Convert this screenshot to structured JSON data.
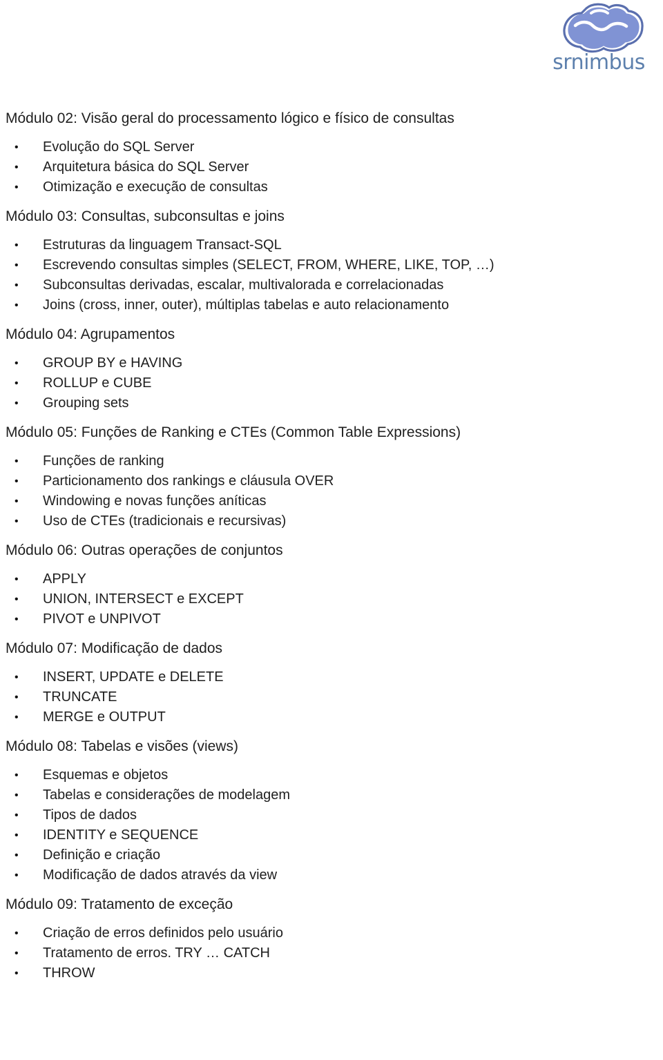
{
  "header": {
    "logo": {
      "icon_name": "cloud-logo-icon",
      "wordmark": "srnimbus",
      "cloud_fill": "#8093d4",
      "cloud_stroke": "#5a6fae",
      "wordmark_color": "#5d80ad"
    }
  },
  "document": {
    "sections": [
      {
        "heading": "Módulo 02: Visão geral do processamento lógico e físico de consultas",
        "items": [
          "Evolução do SQL Server",
          "Arquitetura básica do SQL Server",
          "Otimização e execução de consultas"
        ]
      },
      {
        "heading": "Módulo 03: Consultas, subconsultas e joins",
        "items": [
          "Estruturas da linguagem Transact-SQL",
          "Escrevendo consultas simples (SELECT, FROM, WHERE, LIKE, TOP, …)",
          "Subconsultas derivadas, escalar, multivalorada e correlacionadas",
          "Joins (cross, inner, outer), múltiplas tabelas e auto relacionamento"
        ]
      },
      {
        "heading": "Módulo 04: Agrupamentos",
        "items": [
          "GROUP BY e HAVING",
          "ROLLUP e CUBE",
          "Grouping sets"
        ]
      },
      {
        "heading": "Módulo 05: Funções de Ranking e CTEs (Common Table Expressions)",
        "items": [
          "Funções de ranking",
          "Particionamento dos rankings e cláusula OVER",
          "Windowing e novas funções aníticas",
          "Uso de CTEs (tradicionais e recursivas)"
        ]
      },
      {
        "heading": "Módulo 06: Outras operações de conjuntos",
        "items": [
          "APPLY",
          "UNION, INTERSECT e EXCEPT",
          "PIVOT e UNPIVOT"
        ]
      },
      {
        "heading": "Módulo 07: Modificação de dados",
        "items": [
          "INSERT, UPDATE e DELETE",
          "TRUNCATE",
          "MERGE e OUTPUT"
        ]
      },
      {
        "heading": "Módulo 08: Tabelas e visões (views)",
        "items": [
          "Esquemas e objetos",
          "Tabelas e considerações de modelagem",
          "Tipos de dados",
          "IDENTITY e SEQUENCE",
          "Definição e criação",
          "Modificação de dados através da view"
        ]
      },
      {
        "heading": "Módulo 09: Tratamento de exceção",
        "items": [
          "Criação de erros definidos pelo usuário",
          "Tratamento de erros. TRY … CATCH",
          "THROW"
        ]
      }
    ]
  }
}
